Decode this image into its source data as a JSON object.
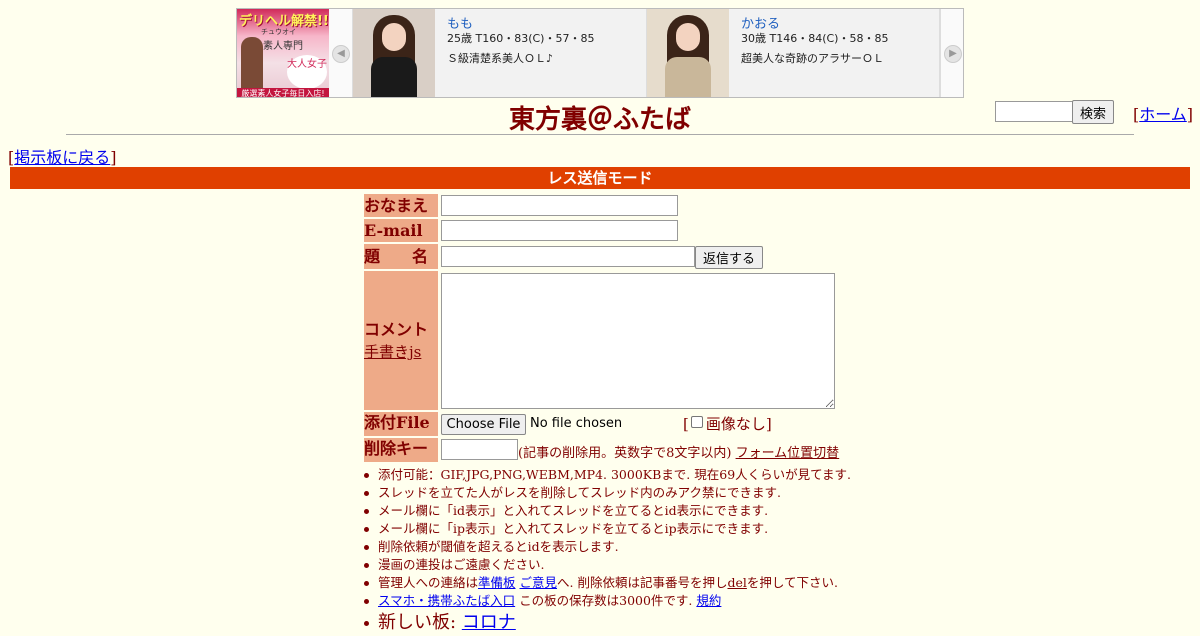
{
  "ad": {
    "logo": {
      "headline": "デリヘル解禁!!",
      "sub": "チュウオイ",
      "tagline": "素人専門",
      "badge": "大人女子",
      "footer": "厳選素人女子毎日入店!"
    },
    "cards": [
      {
        "name": "もも",
        "stats": "25歳 T160・83(C)・57・85",
        "desc": "Ｓ級清楚系美人ＯＬ♪"
      },
      {
        "name": "かおる",
        "stats": "30歳 T146・84(C)・58・85",
        "desc": "超美人な奇跡のアラサーＯＬ"
      }
    ]
  },
  "header": {
    "title": "東方裏＠ふたば",
    "search_button": "検索",
    "home_open": "[",
    "home_label": "ホーム",
    "home_close": "]",
    "back_open": "[",
    "back_label": "掲示板に戻る",
    "back_close": "]"
  },
  "mode_banner": "レス送信モード",
  "form": {
    "name_label": "おなまえ",
    "email_label": "E-mail",
    "subject_label": "題　　名",
    "submit_button": "返信する",
    "comment_label": "コメント",
    "tegaki_link": "手書きjs",
    "file_label": "添付File",
    "file_button": "Choose File",
    "file_status": "No file chosen",
    "noimage_open": "[",
    "noimage_label": "画像なし",
    "noimage_close": "]",
    "delkey_label": "削除キー",
    "delkey_note": "(記事の削除用。英数字で8文字以内)",
    "form_toggle_link": "フォーム位置切替"
  },
  "notes": {
    "n1": "添付可能：GIF,JPG,PNG,WEBM,MP4. 3000KBまで. 現在69人くらいが見てます.",
    "n2": "スレッドを立てた人がレスを削除してスレッド内のみアク禁にできます.",
    "n3": "メール欄に「id表示」と入れてスレッドを立てるとid表示にできます.",
    "n4": "メール欄に「ip表示」と入れてスレッドを立てるとip表示にできます.",
    "n5": "削除依頼が閾値を超えるとidを表示します.",
    "n6": "漫画の連投はご遠慮ください.",
    "n7_pre": "管理人への連絡は",
    "n7_link1": "準備板",
    "n7_space": " ",
    "n7_link2": "ご意見",
    "n7_mid": "へ. 削除依頼は記事番号を押し",
    "n7_del": "del",
    "n7_post": "を押して下さい.",
    "n8_link": "スマホ・携帯ふたば入口",
    "n8_text": " この板の保存数は3000件です. ",
    "n8_rules": "規約",
    "n9_text": "新しい板: ",
    "n9_link": "コロナ"
  },
  "colors": {
    "background": "#ffffee",
    "text": "#800000",
    "banner": "#e04000",
    "label_bg": "#eeaa88"
  }
}
